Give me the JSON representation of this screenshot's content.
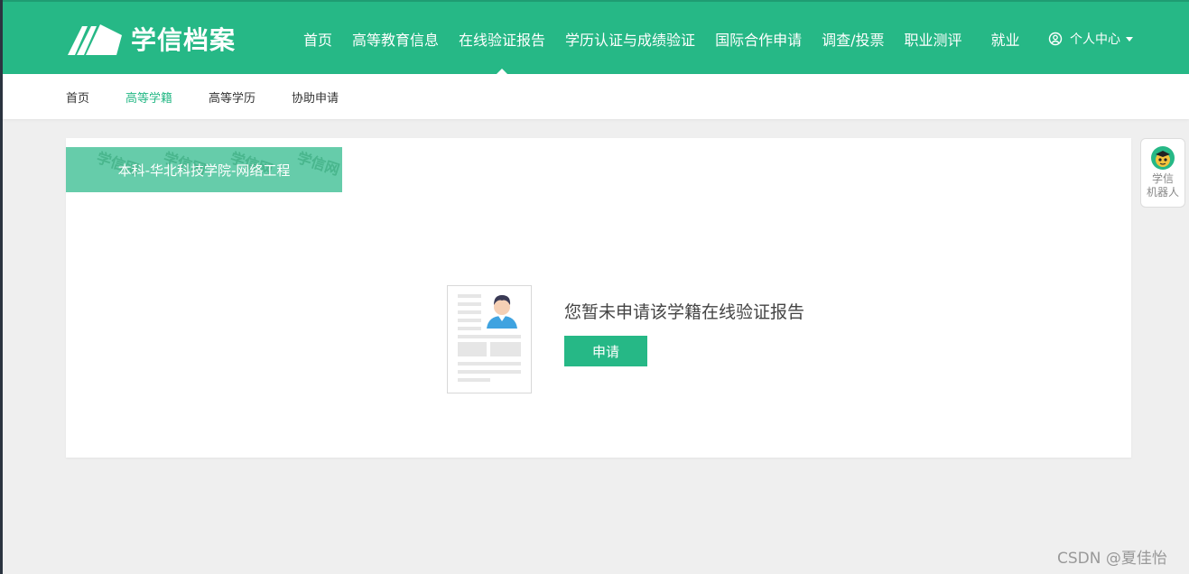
{
  "header": {
    "logo_text": "学信档案",
    "nav": [
      {
        "label": "首页"
      },
      {
        "label": "高等教育信息"
      },
      {
        "label": "在线验证报告"
      },
      {
        "label": "学历认证与成绩验证"
      },
      {
        "label": "国际合作申请"
      },
      {
        "label": "调查/投票"
      },
      {
        "label": "职业测评"
      },
      {
        "label": "就业"
      }
    ],
    "active_nav": "在线验证报告",
    "user_center_label": "个人中心"
  },
  "subnav": {
    "items": [
      {
        "label": "首页"
      },
      {
        "label": "高等学籍"
      },
      {
        "label": "高等学历"
      },
      {
        "label": "协助申请"
      }
    ],
    "active": "高等学籍"
  },
  "card": {
    "tag_label": "本科-华北科技学院-网络工程",
    "tag_watermark": "学信网",
    "empty_message": "您暂未申请该学籍在线验证报告",
    "apply_button": "申请"
  },
  "robot": {
    "label_line1": "学信",
    "label_line2": "机器人"
  },
  "footer_watermark": "CSDN @夏佳怡",
  "colors": {
    "brand": "#26b886",
    "tag_bg": "#66ccaa",
    "page_bg": "#efefef"
  },
  "icons": [
    "logo-icon",
    "user-circle-icon",
    "caret-down-icon",
    "document-avatar-illustration",
    "robot-icon"
  ]
}
